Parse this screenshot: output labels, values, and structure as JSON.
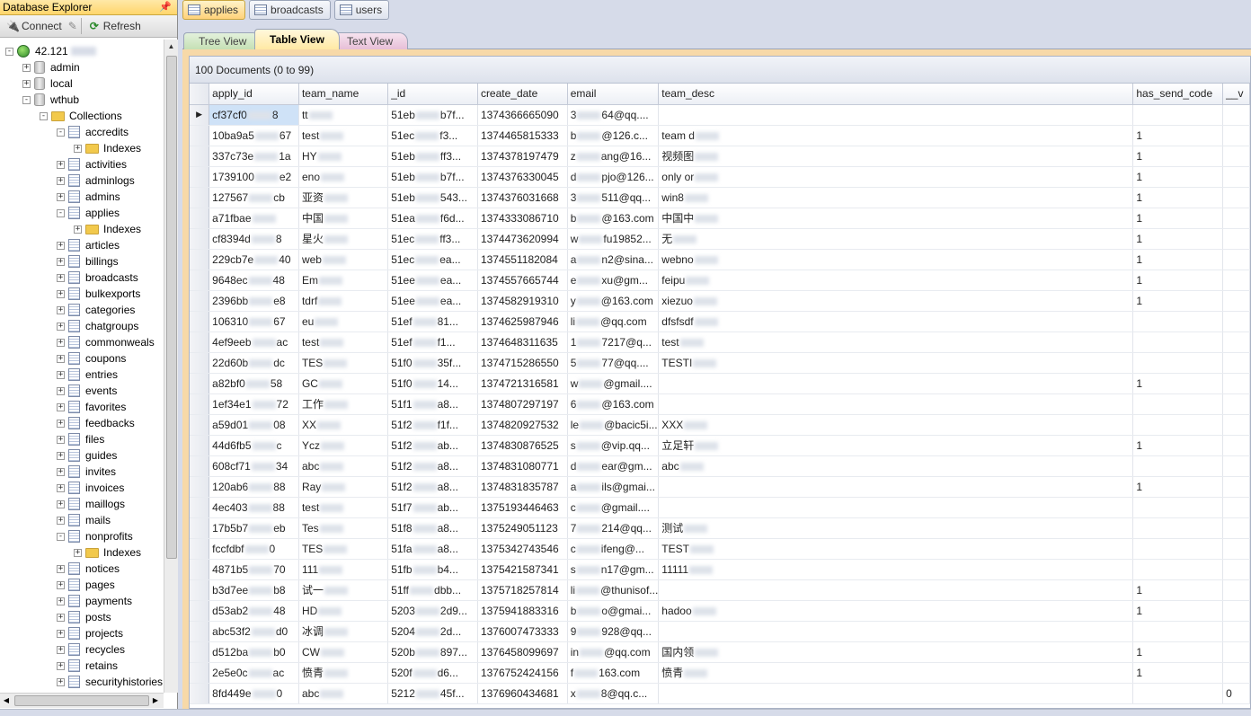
{
  "explorer": {
    "title": "Database Explorer",
    "pin_glyph": "📌",
    "toolbar": {
      "connect": "Connect",
      "refresh": "Refresh"
    }
  },
  "tree": {
    "server": "42.121",
    "databases": [
      "admin",
      "local",
      "wthub"
    ],
    "collections_label": "Collections",
    "indexes_label": "Indexes",
    "collections": [
      "accredits",
      "activities",
      "adminlogs",
      "admins",
      "applies",
      "articles",
      "billings",
      "broadcasts",
      "bulkexports",
      "categories",
      "chatgroups",
      "commonweals",
      "coupons",
      "entries",
      "events",
      "favorites",
      "feedbacks",
      "files",
      "guides",
      "invites",
      "invoices",
      "maillogs",
      "mails",
      "nonprofits",
      "notices",
      "pages",
      "payments",
      "posts",
      "projects",
      "recycles",
      "retains",
      "securityhistories"
    ]
  },
  "tabs": [
    "applies",
    "broadcasts",
    "users"
  ],
  "view_tabs": [
    "Tree View",
    "Table View",
    "Text View"
  ],
  "grid": {
    "status": "100 Documents (0 to 99)",
    "columns": [
      "apply_id",
      "team_name",
      "_id",
      "create_date",
      "email",
      "team_desc",
      "has_send_code",
      "__v"
    ],
    "rows": [
      [
        "cf37cf0",
        "8",
        "tt",
        "",
        "51eb",
        "b7f...",
        "1374366665090",
        "3",
        "64@qq....",
        "",
        "",
        "",
        ""
      ],
      [
        "10ba9a5",
        "67",
        "test",
        "",
        "51ec",
        "f3...",
        "1374465815333",
        "b",
        "@126.c...",
        "team d",
        "",
        "1",
        ""
      ],
      [
        "337c73e",
        "1a",
        "HY",
        "",
        "51eb",
        "ff3...",
        "1374378197479",
        "z",
        "ang@16...",
        "视频图",
        "",
        "1",
        ""
      ],
      [
        "1739100",
        "e2",
        "eno",
        "",
        "51eb",
        "b7f...",
        "1374376330045",
        "d",
        "pjo@126...",
        "only or",
        "",
        "1",
        ""
      ],
      [
        "127567",
        "cb",
        "亚资",
        "",
        "51eb",
        "543...",
        "1374376031668",
        "3",
        "511@qq...",
        "win8",
        "",
        "1",
        ""
      ],
      [
        "a71fbae",
        "",
        "中国",
        "",
        "51ea",
        "f6d...",
        "1374333086710",
        "b",
        "@163.com",
        "中国中",
        "",
        "1",
        ""
      ],
      [
        "cf8394d",
        "8",
        "星火",
        "",
        "51ec",
        "ff3...",
        "1374473620994",
        "w",
        "fu19852...",
        "无",
        "",
        "1",
        ""
      ],
      [
        "229cb7e",
        "40",
        "web",
        "",
        "51ec",
        "ea...",
        "1374551182084",
        "a",
        "n2@sina...",
        "webno",
        "",
        "1",
        ""
      ],
      [
        "9648ec",
        "48",
        "Em",
        "",
        "51ee",
        "ea...",
        "1374557665744",
        "e",
        "xu@gm...",
        "feipu",
        "",
        "1",
        ""
      ],
      [
        "2396bb",
        "e8",
        "tdrf",
        "",
        "51ee",
        "ea...",
        "1374582919310",
        "y",
        "@163.com",
        "xiezuo",
        "",
        "1",
        ""
      ],
      [
        "106310",
        "67",
        "eu",
        "",
        "51ef",
        "81...",
        "1374625987946",
        "li",
        "@qq.com",
        "dfsfsdf",
        "",
        "",
        ""
      ],
      [
        "4ef9eeb",
        "ac",
        "test",
        "",
        "51ef",
        "f1...",
        "1374648311635",
        "1",
        "7217@q...",
        "test",
        "",
        "",
        ""
      ],
      [
        "22d60b",
        "dc",
        "TES",
        "",
        "51f0",
        "35f...",
        "1374715286550",
        "5",
        "77@qq....",
        "TESTI",
        "",
        "",
        ""
      ],
      [
        "a82bf0",
        "58",
        "GC",
        "",
        "51f0",
        "14...",
        "1374721316581",
        "w",
        "@gmail....",
        "",
        "",
        "1",
        ""
      ],
      [
        "1ef34e1",
        "72",
        "工作",
        "",
        "51f1",
        "a8...",
        "1374807297197",
        "6",
        "@163.com",
        "",
        "",
        "",
        ""
      ],
      [
        "a59d01",
        "08",
        "XX",
        "",
        "51f2",
        "f1f...",
        "1374820927532",
        "le",
        "@bacic5i...",
        "XXX",
        "",
        "",
        ""
      ],
      [
        "44d6fb5",
        "c",
        "Ycz",
        "",
        "51f2",
        "ab...",
        "1374830876525",
        "s",
        "@vip.qq...",
        "立足轩",
        "",
        "1",
        ""
      ],
      [
        "608cf71",
        "34",
        "abc",
        "",
        "51f2",
        "a8...",
        "1374831080771",
        "d",
        "ear@gm...",
        "abc",
        "",
        "",
        ""
      ],
      [
        "120ab6",
        "88",
        "Ray",
        "",
        "51f2",
        "a8...",
        "1374831835787",
        "a",
        "ils@gmai...",
        "",
        "",
        "1",
        ""
      ],
      [
        "4ec403",
        "88",
        "test",
        "",
        "51f7",
        "ab...",
        "1375193446463",
        "c",
        "@gmail....",
        "",
        "",
        "",
        ""
      ],
      [
        "17b5b7",
        "eb",
        "Tes",
        "",
        "51f8",
        "a8...",
        "1375249051123",
        "7",
        "214@qq...",
        "测试",
        "",
        "",
        ""
      ],
      [
        "fccfdbf",
        "0",
        "TES",
        "",
        "51fa",
        "a8...",
        "1375342743546",
        "c",
        "ifeng@...",
        "TEST",
        "",
        "",
        ""
      ],
      [
        "4871b5",
        "70",
        "111",
        "",
        "51fb",
        "b4...",
        "1375421587341",
        "s",
        "n17@gm...",
        "11111",
        "",
        "",
        ""
      ],
      [
        "b3d7ee",
        "b8",
        "试一",
        "",
        "51ff",
        "dbb...",
        "1375718257814",
        "li",
        "@thunisof...",
        "",
        "",
        "1",
        ""
      ],
      [
        "d53ab2",
        "48",
        "HD",
        "",
        "5203",
        "2d9...",
        "1375941883316",
        "b",
        "o@gmai...",
        "hadoo",
        "",
        "1",
        ""
      ],
      [
        "abc53f2",
        "d0",
        "冰调",
        "",
        "5204",
        "2d...",
        "1376007473333",
        "9",
        "928@qq...",
        "",
        "",
        "",
        ""
      ],
      [
        "d512ba",
        "b0",
        "CW",
        "",
        "520b",
        "897...",
        "1376458099697",
        "in",
        "@qq.com",
        "国内领",
        "",
        "1",
        ""
      ],
      [
        "2e5e0c",
        "ac",
        "愤青",
        "",
        "520f",
        "d6...",
        "1376752424156",
        "f",
        "163.com",
        "愤青",
        "",
        "1",
        ""
      ],
      [
        "8fd449e",
        "0",
        "abc",
        "",
        "5212",
        "45f...",
        "1376960434681",
        "x",
        "8@qq.c...",
        "",
        "",
        "",
        "0"
      ]
    ]
  }
}
